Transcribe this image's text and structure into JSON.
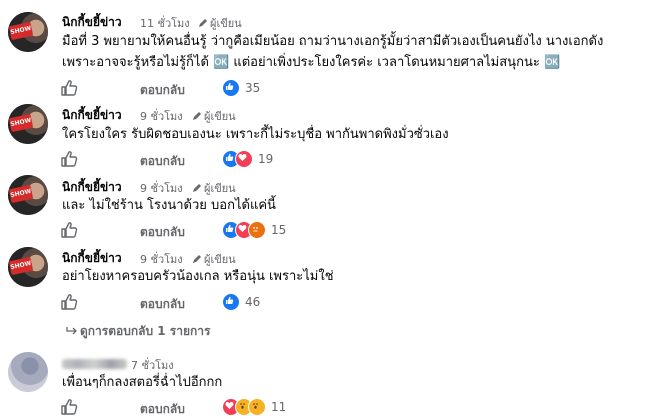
{
  "comments": [
    {
      "name": "นิกกี้ขยี้ข่าว",
      "time": "11 ชั่วโมง",
      "author_badge": "ผู้เขียน",
      "line1": "มือที่ 3 พยายามให้คนอื่นรู้ ว่ากูคือเมียน้อย ถามว่านางเอกรู้มั้ยว่าสามีตัวเองเป็นคนยังไง นางเอกดัง",
      "line2": "เพราะอาจจะรู้หรือไม่รู้ก็ได้ 🆗 แต่อย่าเพิ่งประโยงใครค่ะ เวลาโดนหมายศาลไม่สนุกนะ 🆗",
      "reply_label": "ตอบกลับ",
      "reaction_count": "35",
      "reactions": [
        "like"
      ]
    },
    {
      "name": "นิกกี้ขยี้ข่าว",
      "time": "9 ชั่วโมง",
      "author_badge": "ผู้เขียน",
      "line1": "ใครโยงใคร รับผิดชอบเองนะ เพราะกี้ไม่ระบุชื่อ พากันพาดพิงมั่วซั่วเอง",
      "reply_label": "ตอบกลับ",
      "reaction_count": "19",
      "reactions": [
        "like",
        "love"
      ]
    },
    {
      "name": "นิกกี้ขยี้ข่าว",
      "time": "9 ชั่วโมง",
      "author_badge": "ผู้เขียน",
      "line1": "และ ไม่ใช่ร้าน โรงนาด้วย บอกได้แค่นี้",
      "reply_label": "ตอบกลับ",
      "reaction_count": "15",
      "reactions": [
        "like",
        "love",
        "angry"
      ]
    },
    {
      "name": "นิกกี้ขยี้ข่าว",
      "time": "9 ชั่วโมง",
      "author_badge": "ผู้เขียน",
      "line1": "อย่าโยงหาครอบครัวน้องเกล หรือนุ่น เพราะไม่ใช่",
      "reply_label": "ตอบกลับ",
      "reaction_count": "46",
      "reactions": [
        "like"
      ]
    }
  ],
  "view_replies": "ดูการตอบกลับ 1 รายการ",
  "last_comment": {
    "time": "7 ชั่วโมง",
    "line1": "เพื่อนๆก็กลงสตอรี่ฉ่ำไปอีกกก",
    "reply_label": "ตอบกลับ",
    "reaction_count": "11",
    "reactions": [
      "love",
      "wow",
      "wow"
    ]
  },
  "colors": {
    "like": "#1877f2",
    "love": "#f33e58",
    "angry": "#e9710f",
    "wow": "#f7b125",
    "meta_text": "#65676b"
  }
}
